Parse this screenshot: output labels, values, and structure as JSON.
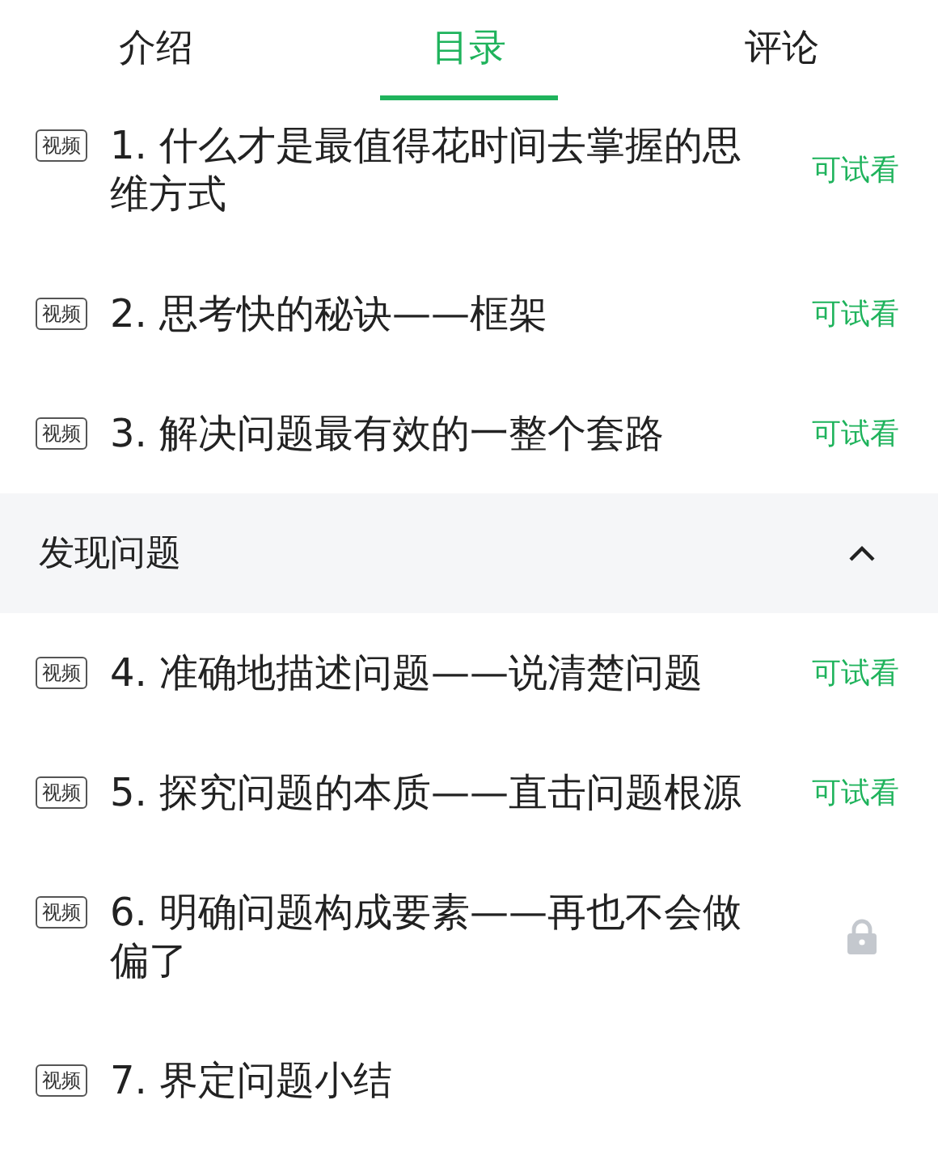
{
  "tabs": [
    {
      "label": "介绍",
      "selected": false
    },
    {
      "label": "目录",
      "selected": true
    },
    {
      "label": "评论",
      "selected": false
    }
  ],
  "entries": [
    {
      "kind": "lesson",
      "badge": "视频",
      "title": "1. 什么才是最值得花时间去掌握的思维方式",
      "access": {
        "kind": "trial",
        "text": "可试看"
      }
    },
    {
      "kind": "lesson",
      "badge": "视频",
      "title": "2. 思考快的秘诀——框架",
      "access": {
        "kind": "trial",
        "text": "可试看"
      }
    },
    {
      "kind": "lesson",
      "badge": "视频",
      "title": "3. 解决问题最有效的一整个套路",
      "access": {
        "kind": "trial",
        "text": "可试看"
      }
    },
    {
      "kind": "section",
      "title": "发现问题",
      "expanded": true
    },
    {
      "kind": "lesson",
      "badge": "视频",
      "title": "4. 准确地描述问题——说清楚问题",
      "access": {
        "kind": "trial",
        "text": "可试看"
      }
    },
    {
      "kind": "lesson",
      "badge": "视频",
      "title": "5. 探究问题的本质——直击问题根源",
      "access": {
        "kind": "trial",
        "text": "可试看"
      }
    },
    {
      "kind": "lesson",
      "badge": "视频",
      "title": "6. 明确问题构成要素——再也不会做偏了",
      "access": {
        "kind": "locked"
      }
    },
    {
      "kind": "lesson",
      "badge": "视频",
      "title": "7. 界定问题小结"
    }
  ]
}
